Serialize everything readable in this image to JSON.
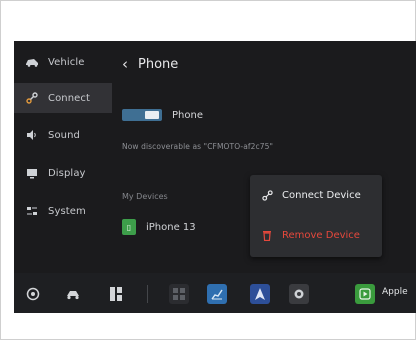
{
  "sidebar": {
    "items": [
      {
        "label": "Vehicle",
        "icon": "car-icon",
        "active": false
      },
      {
        "label": "Connect",
        "icon": "link-icon",
        "active": true
      },
      {
        "label": "Sound",
        "icon": "speaker-icon",
        "active": false
      },
      {
        "label": "Display",
        "icon": "display-icon",
        "active": false
      },
      {
        "label": "System",
        "icon": "sliders-icon",
        "active": false
      }
    ]
  },
  "header": {
    "title": "Phone",
    "back_icon": "chevron-left-icon"
  },
  "phone": {
    "toggle_label": "Phone",
    "toggle_on": true,
    "discoverable_text": "Now discoverable as \"CFMOTO-af2c75\""
  },
  "devices": {
    "section_label": "My Devices",
    "items": [
      {
        "name": "iPhone 13",
        "icon": "phone-icon"
      }
    ]
  },
  "context_menu": {
    "connect_label": "Connect Device",
    "remove_label": "Remove Device",
    "connect_icon": "link-icon",
    "remove_icon": "trash-icon"
  },
  "dock": {
    "apple_label": "Apple",
    "icons": [
      "camera-icon",
      "motorcycle-icon",
      "grid-icon",
      "apps-icon",
      "chart-icon",
      "navigation-icon",
      "settings-icon",
      "carplay-icon"
    ]
  },
  "colors": {
    "screen_bg": "#1b1b1d",
    "active_item": "#323236",
    "toggle": "#3f6f93",
    "remove_red": "#e5483c",
    "device_green": "#3d9e4a",
    "carplay_green": "#3a9b3d",
    "chart_blue": "#2f6fb0",
    "nav_blue": "#2d4f99"
  }
}
